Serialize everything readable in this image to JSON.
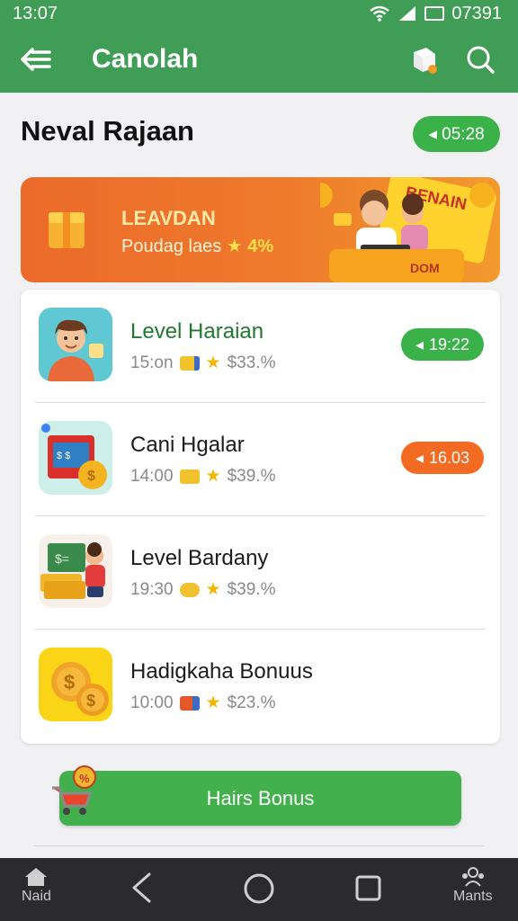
{
  "status": {
    "time": "13:07",
    "battery_text": "07391"
  },
  "appbar": {
    "title": "Canolah",
    "back_icon": "arrow-left-icon",
    "gift_icon": "gift-box-icon",
    "search_icon": "search-icon"
  },
  "header": {
    "title": "Neval Rajaan",
    "timer": "05:28"
  },
  "banner": {
    "title": "LEAVDAN",
    "subtitle": "Poudag laes",
    "subtitle_highlight": "4%",
    "art_text_1": "BENAIN",
    "art_text_2": "DOM"
  },
  "items": [
    {
      "title": "Level Haraian",
      "time": "15:on",
      "price": "$33.%",
      "pill": "19:22",
      "pill_color": "#3bb14a"
    },
    {
      "title": "Cani Hgalar",
      "time": "14:00",
      "price": "$39.%",
      "pill": "16.03",
      "pill_color": "#f36a22"
    },
    {
      "title": "Level Bardany",
      "time": "19:30",
      "price": "$39.%"
    },
    {
      "title": "Hadigkaha Bonuus",
      "time": "10:00",
      "price": "$23.%"
    }
  ],
  "bonus_button": {
    "label": "Hairs Bonus"
  },
  "nav": {
    "home_label": "Naid",
    "menu_label": "Mants"
  },
  "colors": {
    "primary": "#3f9d55",
    "accent_orange": "#f36a22",
    "pill_green": "#3bb14a"
  }
}
